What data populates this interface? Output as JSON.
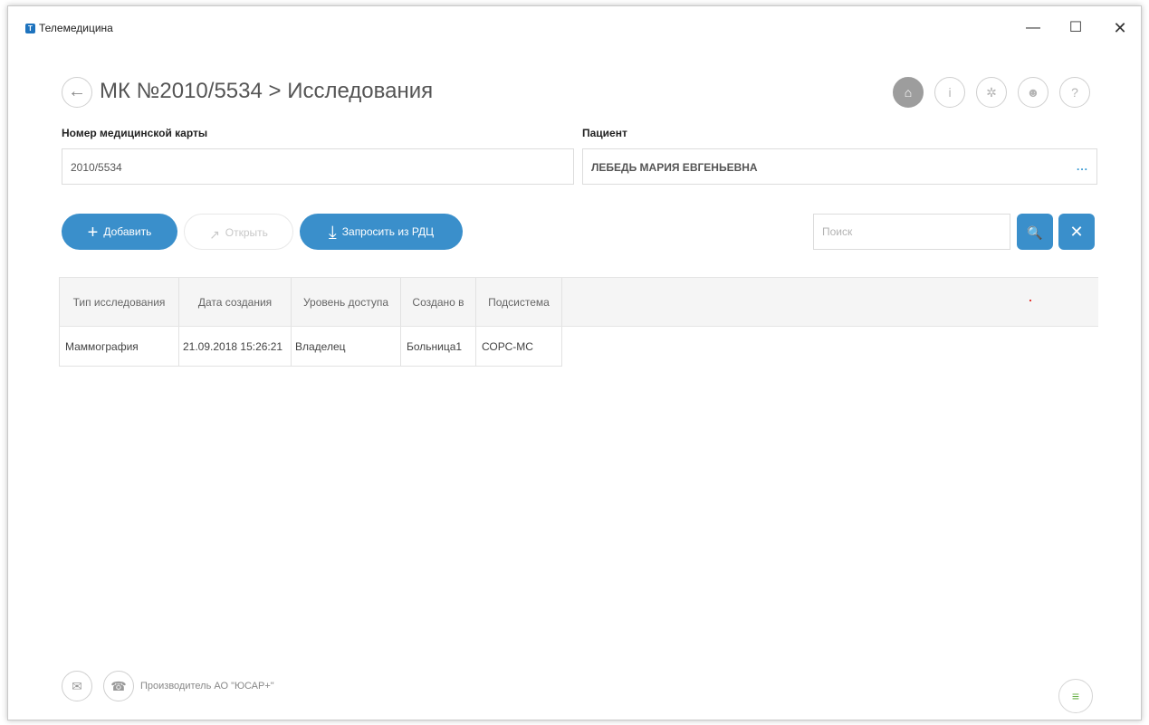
{
  "window": {
    "title": "Телемедицина",
    "logo_letter": "Т",
    "minimize_glyph": "—",
    "maximize_glyph": "☐",
    "close_glyph": "✕"
  },
  "header": {
    "back_glyph": "←",
    "title": "МК №2010/5534 > Исследования",
    "nav_buttons": [
      {
        "name": "home-icon",
        "glyph": "⌂"
      },
      {
        "name": "info-icon",
        "glyph": "i"
      },
      {
        "name": "gear-icon",
        "glyph": "✲"
      },
      {
        "name": "user-icon",
        "glyph": "☻"
      },
      {
        "name": "help-icon",
        "glyph": "?"
      }
    ]
  },
  "fields": {
    "card_number_label": "Номер медицинской карты",
    "card_number_value": "2010/5534",
    "patient_label": "Пациент",
    "patient_value": "ЛЕБЕДЬ МАРИЯ ЕВГЕНЬЕВНА",
    "patient_more": "..."
  },
  "toolbar": {
    "add_label": "Добавить",
    "add_icon": "+",
    "open_label": "Открыть",
    "open_icon": "↗",
    "request_label": "Запросить из РДЦ",
    "request_icon": "⤓",
    "search_placeholder": "Поиск",
    "search_icon": "🔍",
    "clear_icon": "✕"
  },
  "table": {
    "columns": [
      "Тип исследования",
      "Дата создания",
      "Уровень доступа",
      "Создано в",
      "Подсистема"
    ],
    "rows": [
      [
        "Маммография",
        "21.09.2018 15:26:21",
        "Владелец",
        "Больница1",
        "СОРС-МС"
      ]
    ]
  },
  "footer": {
    "mail_icon": "✉",
    "phone_icon": "☎",
    "vendor": "Производитель АО \"ЮСАР+\"",
    "db_icon": "≡"
  },
  "colors": {
    "accent": "#3a8fcb",
    "home_button": "#9d9d9d",
    "db_icon": "#6bb34a"
  }
}
